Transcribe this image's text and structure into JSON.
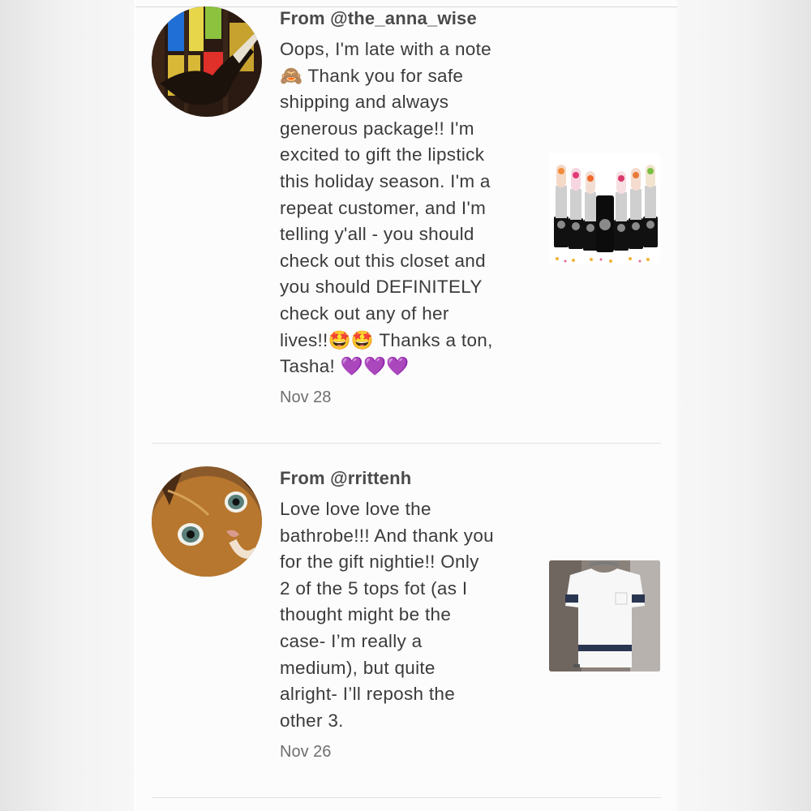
{
  "notes": [
    {
      "author": "From @the_anna_wise",
      "text": "Oops, I'm late with a note\n🙈 Thank you for safe\nshipping and always\ngenerous package!! I'm\nexcited to gift the lipstick\nthis holiday season. I'm a\nrepeat customer, and I'm\ntelling y'all - you should\ncheck out this closet and\nyou should DEFINITELY\ncheck out any of her\nlives!!🤩🤩 Thanks a ton,\nTasha! 💜💜💜",
      "date": "Nov 28"
    },
    {
      "author": "From @rrittenh",
      "text": "Love love love the\nbathrobe!!! And thank you\nfor the gift nightie!! Only\n2 of the 5 tops fot (as I\nthought might be the\ncase- I’m really a\nmedium), but quite\nalright- I’ll reposh the\nother 3.",
      "date": "Nov 26"
    }
  ],
  "colors": {
    "panel": "#fcfcfc",
    "text": "#3b3b3b",
    "date": "#6f6f6f",
    "divider": "#e3e3e3"
  }
}
